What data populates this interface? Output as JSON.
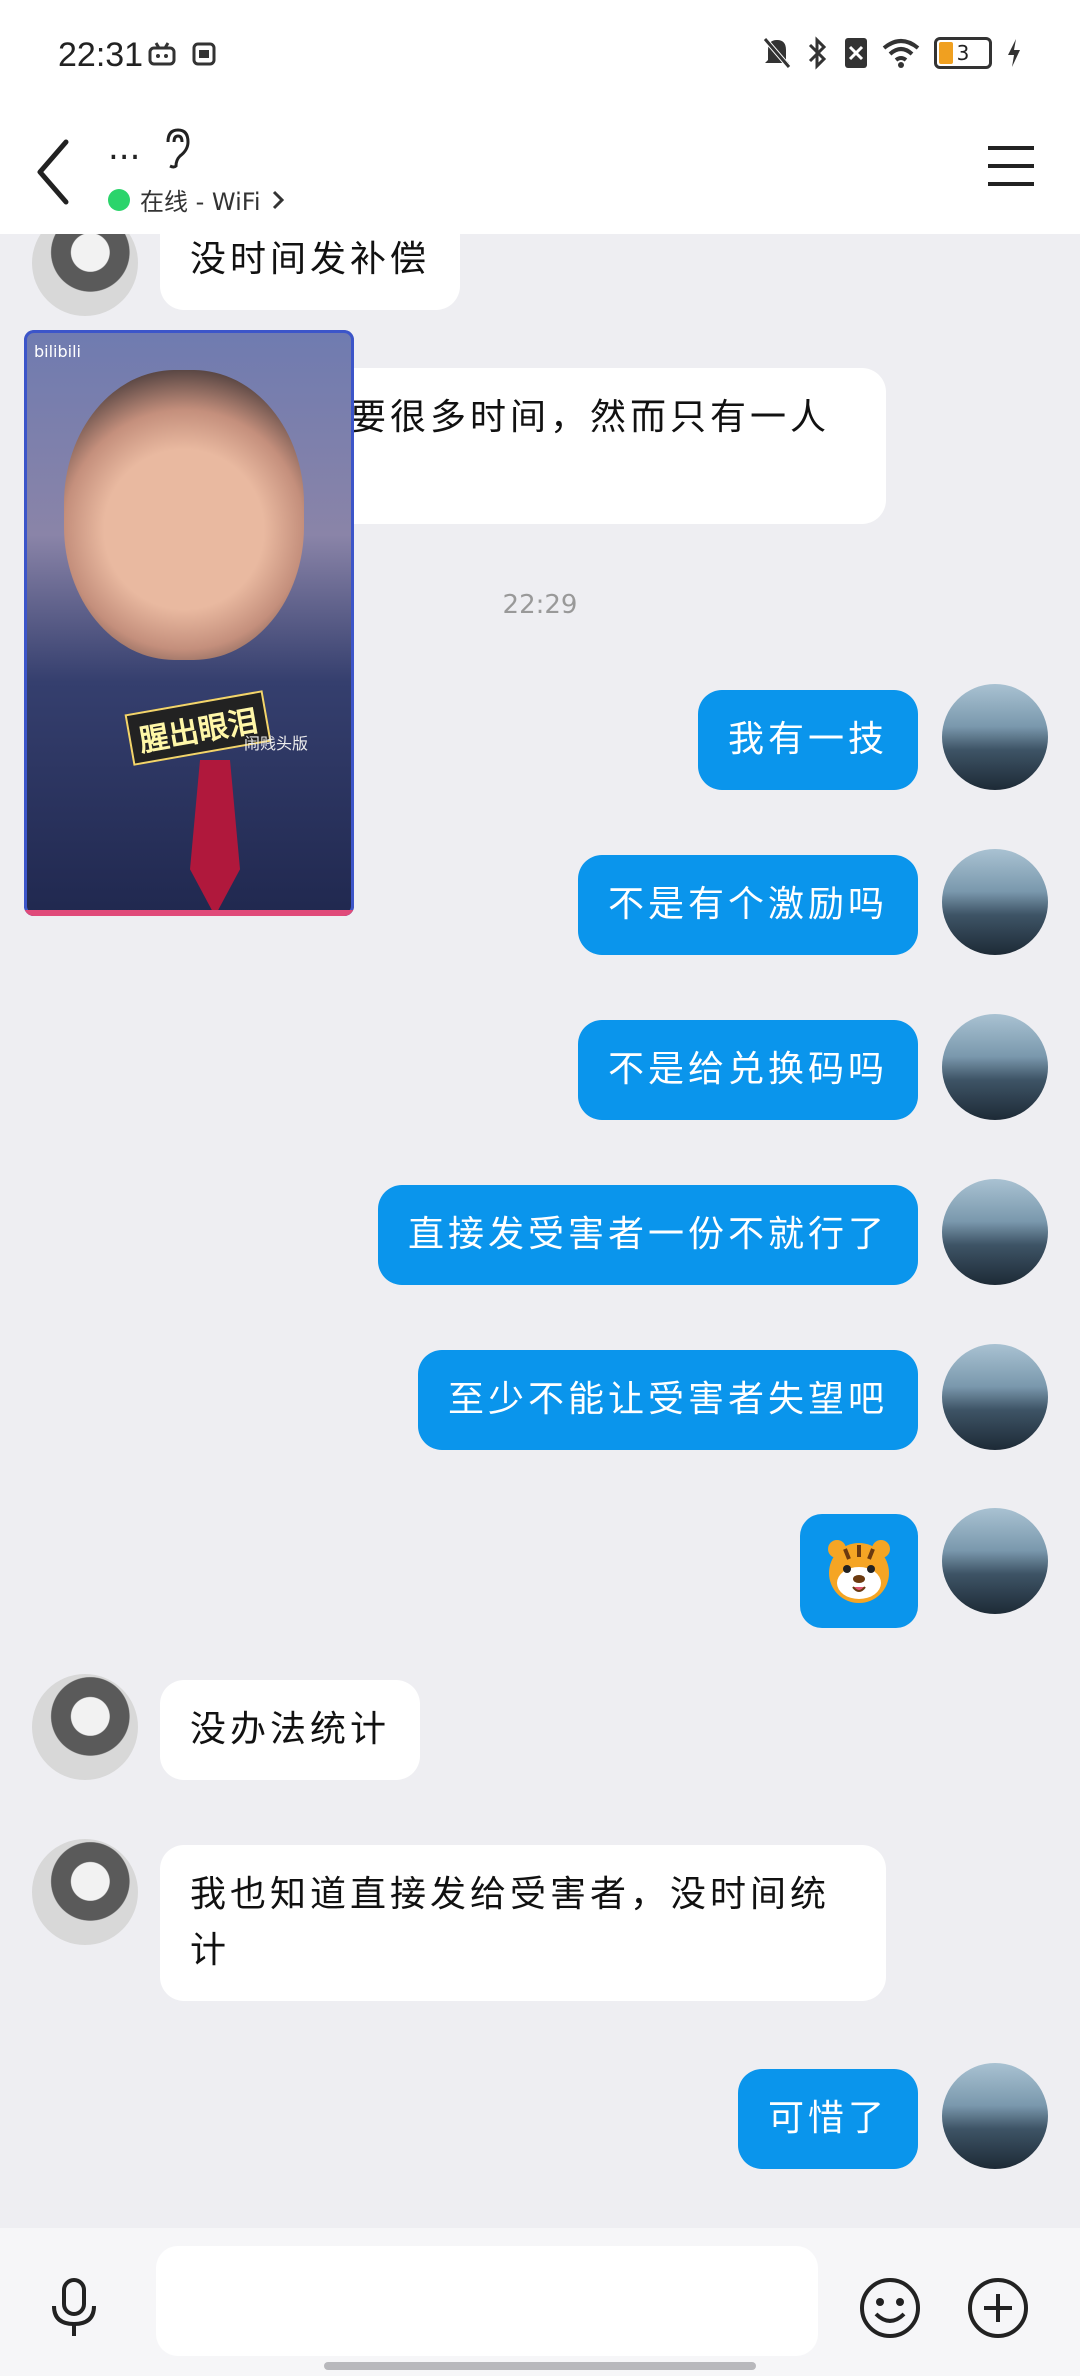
{
  "status": {
    "time": "22:31",
    "battery": "3"
  },
  "header": {
    "name": "...",
    "online": "在线 - WiFi"
  },
  "messages": {
    "m1": "没时间发补偿",
    "m2": "补发都需要很多时间，然而只有一人开发",
    "timestamp": "22:29",
    "m3": "我有一技",
    "m4": "不是有个激励吗",
    "m5": "不是给兑换码吗",
    "m6": "直接发受害者一份不就行了",
    "m7": "至少不能让受害者失望吧",
    "m8": "没办法统计",
    "m9": "我也知道直接发给受害者，没时间统计",
    "m10": "可惜了"
  },
  "video": {
    "caption": "腥出眼泪",
    "logo": "bilibili",
    "watermark": "闹贱头版"
  },
  "input": {
    "placeholder": ""
  },
  "colors": {
    "accent": "#0a95ec",
    "online": "#2bd46b",
    "background": "#eeeef2"
  }
}
